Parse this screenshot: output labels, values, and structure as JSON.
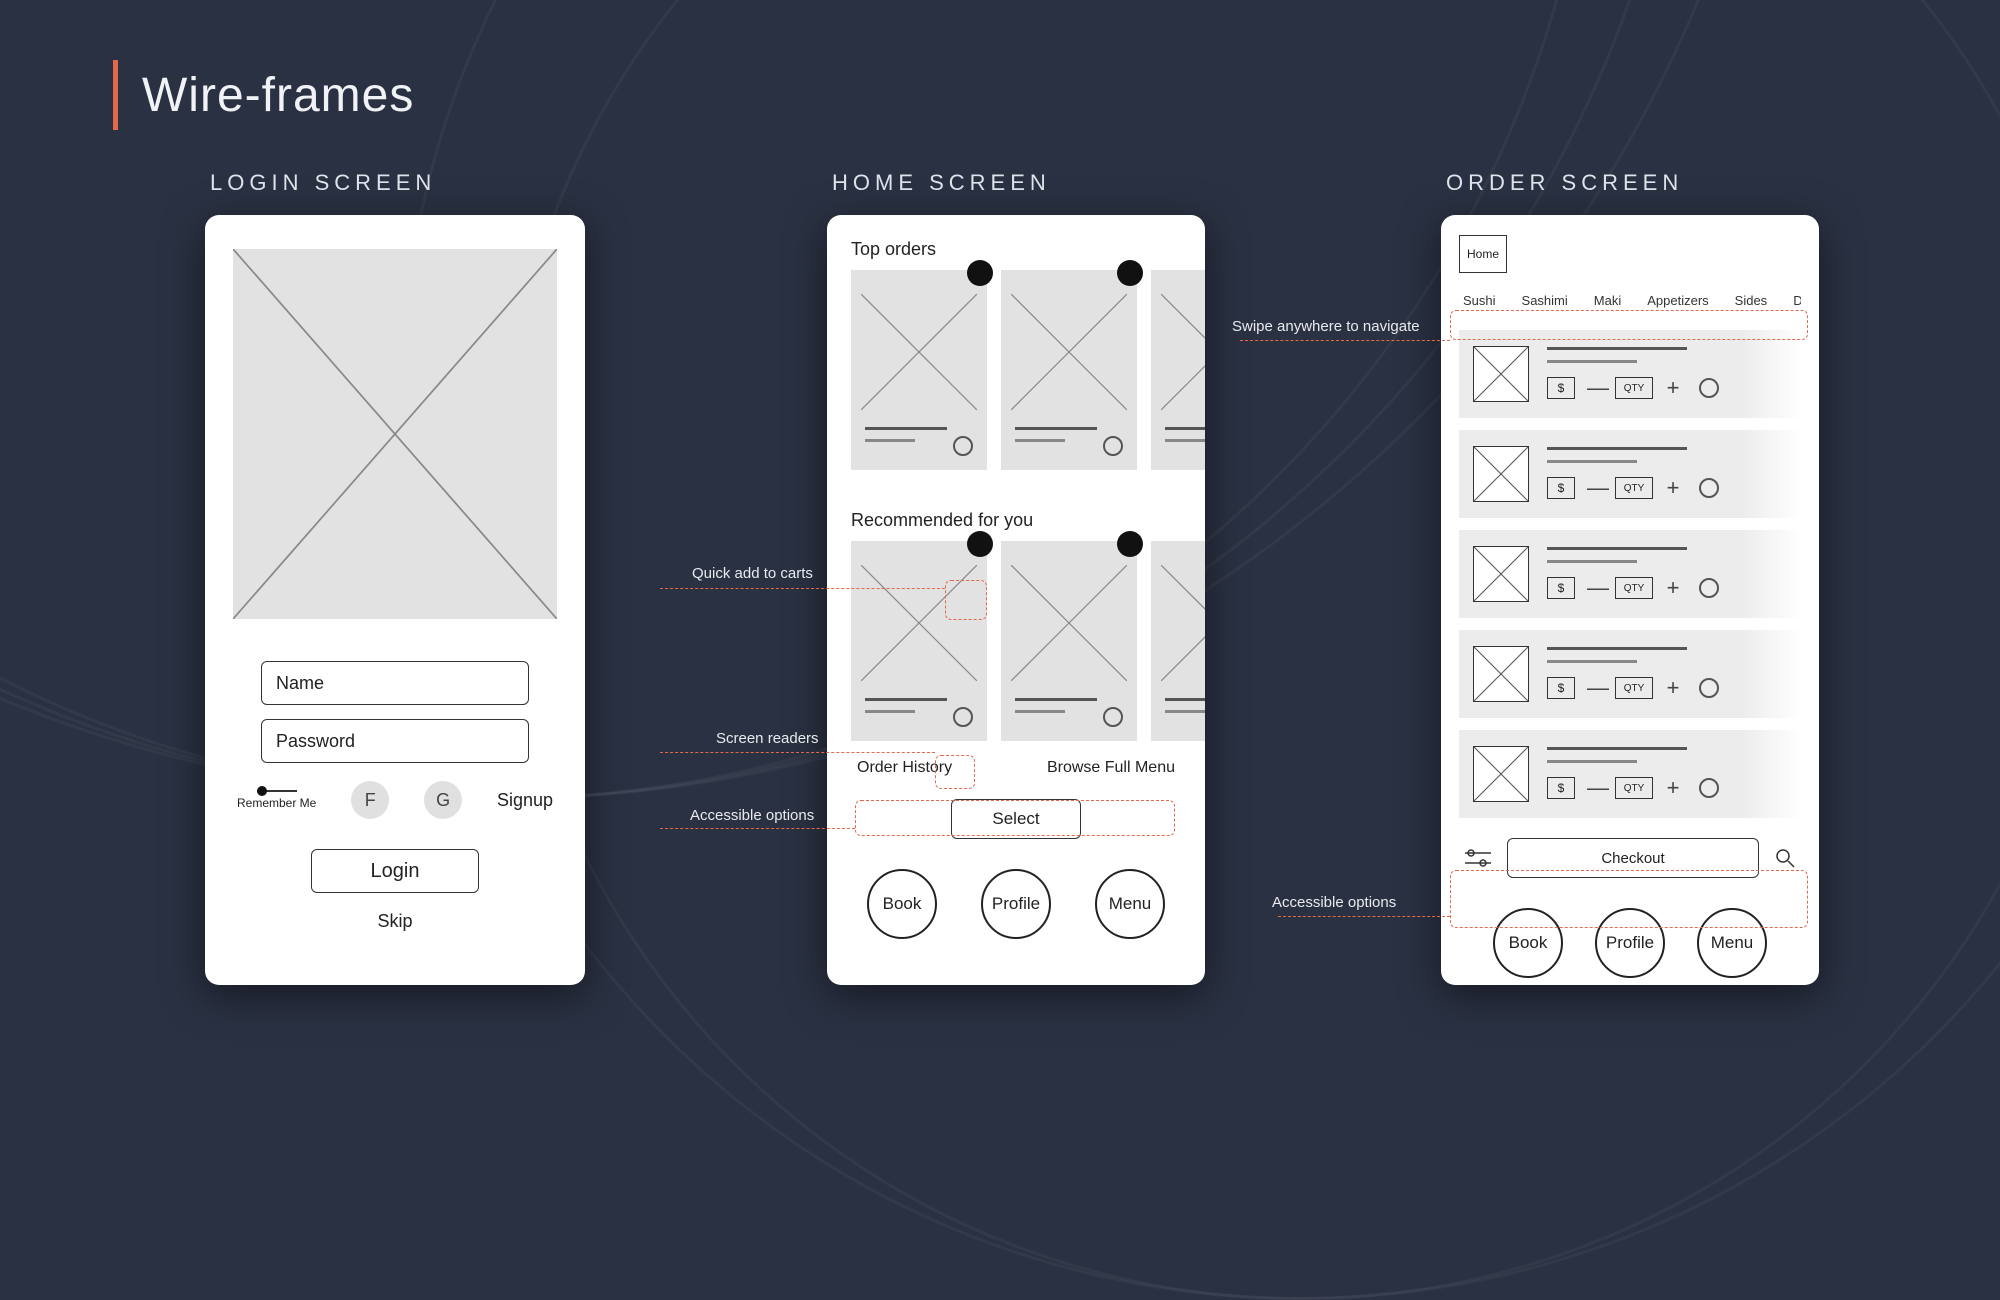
{
  "page": {
    "title": "Wire-frames"
  },
  "screens": {
    "login": {
      "label": "LOGIN SCREEN"
    },
    "home": {
      "label": "HOME SCREEN"
    },
    "order": {
      "label": "ORDER SCREEN"
    }
  },
  "login": {
    "name_placeholder": "Name",
    "password_placeholder": "Password",
    "remember_label": "Remember Me",
    "social_f": "F",
    "social_g": "G",
    "signup": "Signup",
    "login_btn": "Login",
    "skip": "Skip"
  },
  "home": {
    "top_heading": "Top orders",
    "rec_heading": "Recommended for you",
    "order_history": "Order History",
    "browse_menu": "Browse Full Menu",
    "select_btn": "Select",
    "nav": {
      "book": "Book",
      "profile": "Profile",
      "menu": "Menu"
    }
  },
  "order": {
    "home_chip": "Home",
    "categories": [
      "Sushi",
      "Sashimi",
      "Maki",
      "Appetizers",
      "Sides",
      "Desse"
    ],
    "price_symbol": "$",
    "qty_label": "QTY",
    "checkout": "Checkout",
    "nav": {
      "book": "Book",
      "profile": "Profile",
      "menu": "Menu"
    }
  },
  "annotations": {
    "swipe": "Swipe anywhere to navigate",
    "quick_add": "Quick add to carts",
    "screen_readers": "Screen readers",
    "accessible_home": "Accessible options",
    "accessible_order": "Accessible options"
  }
}
